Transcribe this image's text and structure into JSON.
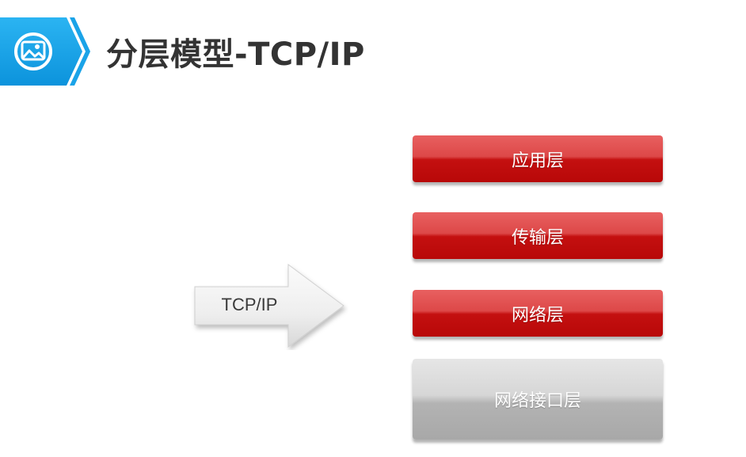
{
  "header": {
    "title": "分层模型-TCP/IP",
    "accent_color": "#1aa3e8",
    "icon": "image-icon"
  },
  "arrow": {
    "label": "TCP/IP"
  },
  "layers": [
    {
      "label": "应用层",
      "color": "#d42a2a"
    },
    {
      "label": "传输层",
      "color": "#d42a2a"
    },
    {
      "label": "网络层",
      "color": "#d42a2a"
    },
    {
      "label": "网络接口层",
      "color": "#bdbdbd"
    }
  ]
}
